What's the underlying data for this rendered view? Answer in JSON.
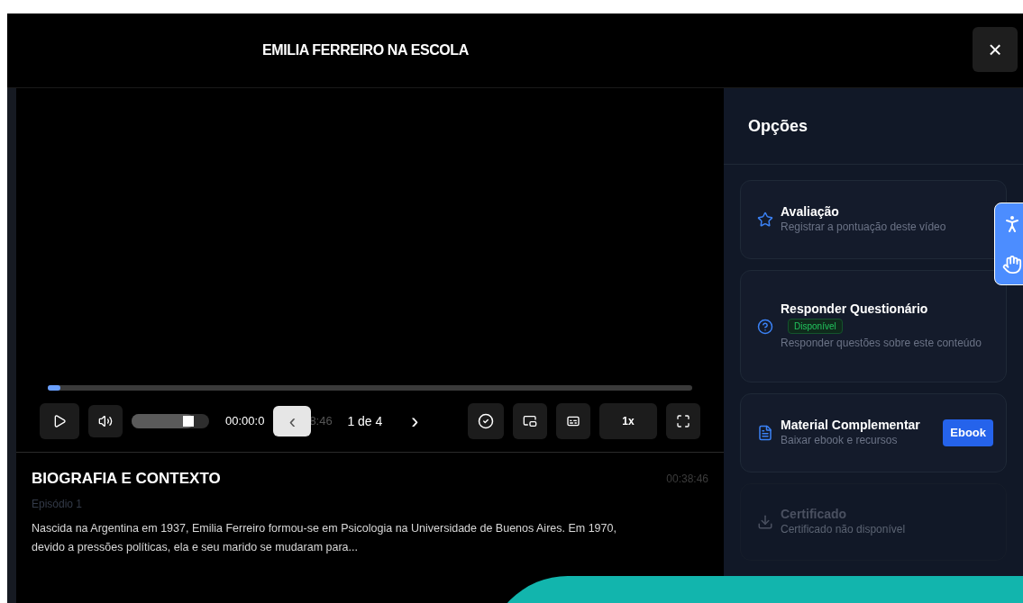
{
  "header": {
    "title": "EMILIA FERREIRO NA ESCOLA",
    "close": "×"
  },
  "player": {
    "progress": {
      "level": 0.02
    },
    "volume": {
      "level": 0.8
    },
    "time_start": "00:00:0",
    "time_end_fragment": "8:46",
    "pager": {
      "prev": "‹",
      "label": "1 de 4",
      "next": "›"
    },
    "speed": "1x"
  },
  "episode": {
    "title": "BIOGRAFIA E CONTEXTO",
    "duration": "00:38:46",
    "subtitle": "Episódio 1",
    "description": "Nascida na Argentina em 1937, Emilia Ferreiro formou-se em Psicologia na Universidade de Buenos Aires. Em 1970, devido a pressões políticas, ela e seu marido se mudaram para..."
  },
  "options": {
    "title": "Opções",
    "items": [
      {
        "kind": "rating",
        "title": "Avaliação",
        "description": "Registrar a pontuação deste vídeo",
        "disabled": false
      },
      {
        "kind": "quiz",
        "title": "Responder Questionário",
        "badge": "Disponível",
        "description": "Responder questões sobre este conteúdo",
        "disabled": false
      },
      {
        "kind": "material",
        "title": "Material Complementar",
        "description": "Baixar ebook e recursos",
        "action": "Ebook",
        "disabled": false
      },
      {
        "kind": "certificate",
        "title": "Certificado",
        "description": "Certificado não disponível",
        "disabled": true
      }
    ]
  }
}
